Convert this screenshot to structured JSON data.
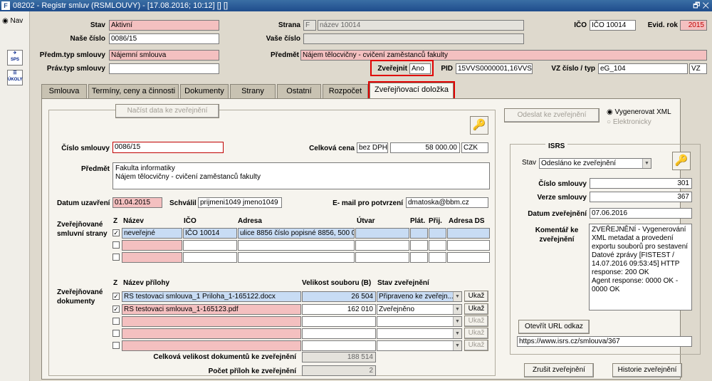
{
  "window": {
    "title": "08202 - Registr smluv (RSMLOUVY) - [17.08.2016; 10:12] [] []",
    "controls": "🗗 ✕"
  },
  "left": {
    "nav_label": "Nav",
    "sps": "SPS",
    "ukoly": "ÚKOLY"
  },
  "header": {
    "stav_label": "Stav",
    "stav": "Aktivní",
    "strana_label": "Strana",
    "strana_code": "F",
    "strana_name": "název 10014",
    "ico_label": "IČO",
    "ico": "IČO 10014",
    "evid_rok_label": "Evid. rok",
    "evid_rok": "2015",
    "nase_cislo_label": "Naše číslo",
    "nase_cislo": "0086/15",
    "vase_cislo_label": "Vaše číslo",
    "vase_cislo": "",
    "predm_typ_label": "Předm.typ smlouvy",
    "predm_typ": "Nájemní smlouva",
    "predmet_label": "Předmět",
    "predmet": "Nájem tělocvičny - cvičení zaměstanců fakulty",
    "prav_typ_label": "Práv.typ smlouvy",
    "prav_typ": "",
    "zverejnit_label": "Zveřejnit",
    "zverejnit": "Ano",
    "pid_label": "PID",
    "pid": "15VVS0000001,16VVS0",
    "vz_label": "VZ číslo / typ",
    "vz_cislo": "eG_104",
    "vz_typ": "VZ"
  },
  "tabs": [
    "Smlouva",
    "Termíny, ceny a činnosti",
    "Dokumenty",
    "Strany",
    "Ostatní",
    "Rozpočet",
    "Zveřejňovací doložka"
  ],
  "form": {
    "nacist_btn": "Načíst data ke zveřejnění",
    "cislo_smlouvy_label": "Číslo smlouvy",
    "cislo_smlouvy": "0086/15",
    "celkova_cena_label": "Celková cena",
    "cena_typ": "bez DPH",
    "cena": "58 000.00",
    "mena": "CZK",
    "predmet_label": "Předmět",
    "predmet_line1": "Fakulta informatiky",
    "predmet_line2": "Nájem tělocvičny - cvičení zaměstanců fakulty",
    "datum_uzavreni_label": "Datum uzavření",
    "datum_uzavreni": "01.04.2015",
    "schvalil_label": "Schválil",
    "schvalil": "prijmeni1049 jmeno1049",
    "email_label": "E- mail pro potvrzení",
    "email": "dmatoska@bbm.cz",
    "strany_label1": "Zveřejňované",
    "strany_label2": "smluvní strany",
    "strany_cols": [
      "Z",
      "Název",
      "IČO",
      "Adresa",
      "Útvar",
      "Plát.",
      "Přij.",
      "Adresa DS"
    ],
    "strany_row1": {
      "check": "✓",
      "nazev": "neveřejné",
      "ico": "IČO 10014",
      "adresa": "ulice 8856 číslo popisné 8856, 500 06"
    },
    "dok_label1": "Zveřejňované",
    "dok_label2": "dokumenty",
    "dok_cols": [
      "Z",
      "Název přílohy",
      "Velikost souboru (B)",
      "Stav zveřejnění"
    ],
    "dok_rows": [
      {
        "check": "✓",
        "nazev": "RS testovaci smlouva_1 Priloha_1-165122.docx",
        "velikost": "26 504",
        "stav": "Připraveno ke zveřejn...",
        "ukaz": "Ukaž"
      },
      {
        "check": "✓",
        "nazev": "RS testovaci smlouva_1-165123.pdf",
        "velikost": "162 010",
        "stav": "Zveřejněno",
        "ukaz": "Ukaž"
      }
    ],
    "ukaz_label": "Ukaž",
    "celk_velikost_label": "Celková velikost dokumentů ke zveřejnění",
    "celk_velikost": "188 514",
    "pocet_priloh_label": "Počet příloh ke zveřejnění",
    "pocet_priloh": "2"
  },
  "right": {
    "odeslat_btn": "Odeslat ke zveřejnění",
    "radio_xml": "Vygenerovat XML",
    "radio_el": "Elektronicky",
    "isrs_title": "ISRS",
    "stav_label": "Stav",
    "stav": "Odesláno ke zveřejnění",
    "cislo_label": "Číslo smlouvy",
    "cislo": "301",
    "verze_label": "Verze smlouvy",
    "verze": "367",
    "datum_label": "Datum zveřejnění",
    "datum": "07.06.2016",
    "komentar_label1": "Komentář ke",
    "komentar_label2": "zveřejnění",
    "komentar": "ZVEŘEJNĚNÍ - Vygenerování XML metadat a provedení exportu souborů pro sestavení Datové zprávy [FISTEST / 14.07.2016 09:53:45] HTTP response: 200 OK\nAgent response: 0000 OK  - 0000 OK",
    "url_btn": "Otevřít URL odkaz",
    "url": "https://www.isrs.cz/smlouva/367",
    "zrusit_btn": "Zrušit zveřejnění",
    "historie_btn": "Historie zveřejnění"
  },
  "colors": {
    "accent_red": "#e00000",
    "pink": "#f4c0c0",
    "blue": "#c8dcf4"
  }
}
